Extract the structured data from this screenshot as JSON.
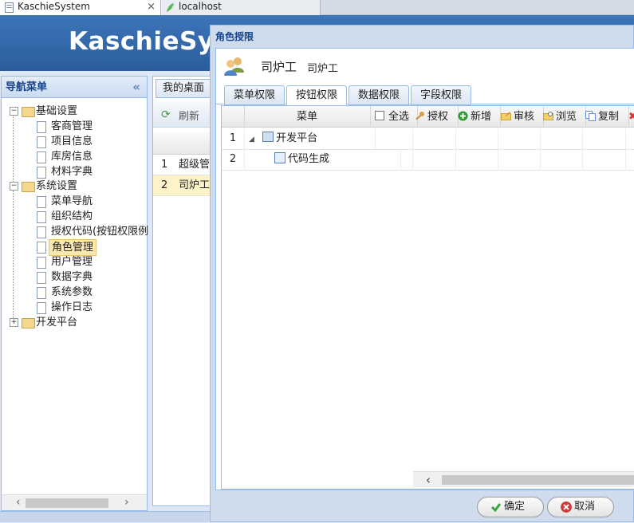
{
  "browser": {
    "tabs": [
      {
        "label": "KaschieSystem",
        "active": true
      },
      {
        "label": "localhost",
        "active": false
      }
    ]
  },
  "app": {
    "title": "KaschieSystem"
  },
  "nav": {
    "title": "导航菜单",
    "collapse_symbol": "«",
    "groups": [
      {
        "label": "基础设置",
        "expanded": true,
        "items": [
          "客商管理",
          "项目信息",
          "库房信息",
          "材料字典"
        ]
      },
      {
        "label": "系统设置",
        "expanded": true,
        "items": [
          "菜单导航",
          "组织结构",
          "授权代码(按钮权限例",
          "角色管理",
          "用户管理",
          "数据字典",
          "系统参数",
          "操作日志"
        ]
      },
      {
        "label": "开发平台",
        "expanded": false,
        "items": []
      }
    ],
    "selected": "角色管理"
  },
  "center": {
    "tab": "我的桌面",
    "toolbar_refresh": "刷新",
    "rows": [
      {
        "num": "1",
        "text": "超级管"
      },
      {
        "num": "2",
        "text": "司炉工"
      }
    ]
  },
  "dialog": {
    "title": "角色授限",
    "role_name": "司炉工",
    "role_desc": "司炉工",
    "tabs": [
      "菜单权限",
      "按钮权限",
      "数据权限",
      "字段权限"
    ],
    "active_tab": "按钮权限",
    "grid": {
      "headers": {
        "menu": "菜单",
        "select_all": "全选",
        "actions": [
          {
            "label": "授权",
            "icon": "key-icon",
            "color": "#c98a3a"
          },
          {
            "label": "新增",
            "icon": "add-icon",
            "color": "#2e9b2e"
          },
          {
            "label": "审核",
            "icon": "folder-edit-icon",
            "color": "#e0b040"
          },
          {
            "label": "浏览",
            "icon": "folder-view-icon",
            "color": "#e0b040"
          },
          {
            "label": "复制",
            "icon": "copy-icon",
            "color": "#6b8fc4"
          }
        ]
      },
      "rows": [
        {
          "num": "1",
          "label": "开发平台",
          "level": 0
        },
        {
          "num": "2",
          "label": "代码生成",
          "level": 1
        }
      ]
    },
    "buttons": {
      "ok": "确定",
      "cancel": "取消"
    }
  },
  "colors": {
    "header_blue": "#2f66a8",
    "ok_green": "#3aa53a",
    "cancel_red": "#d23a3a"
  }
}
